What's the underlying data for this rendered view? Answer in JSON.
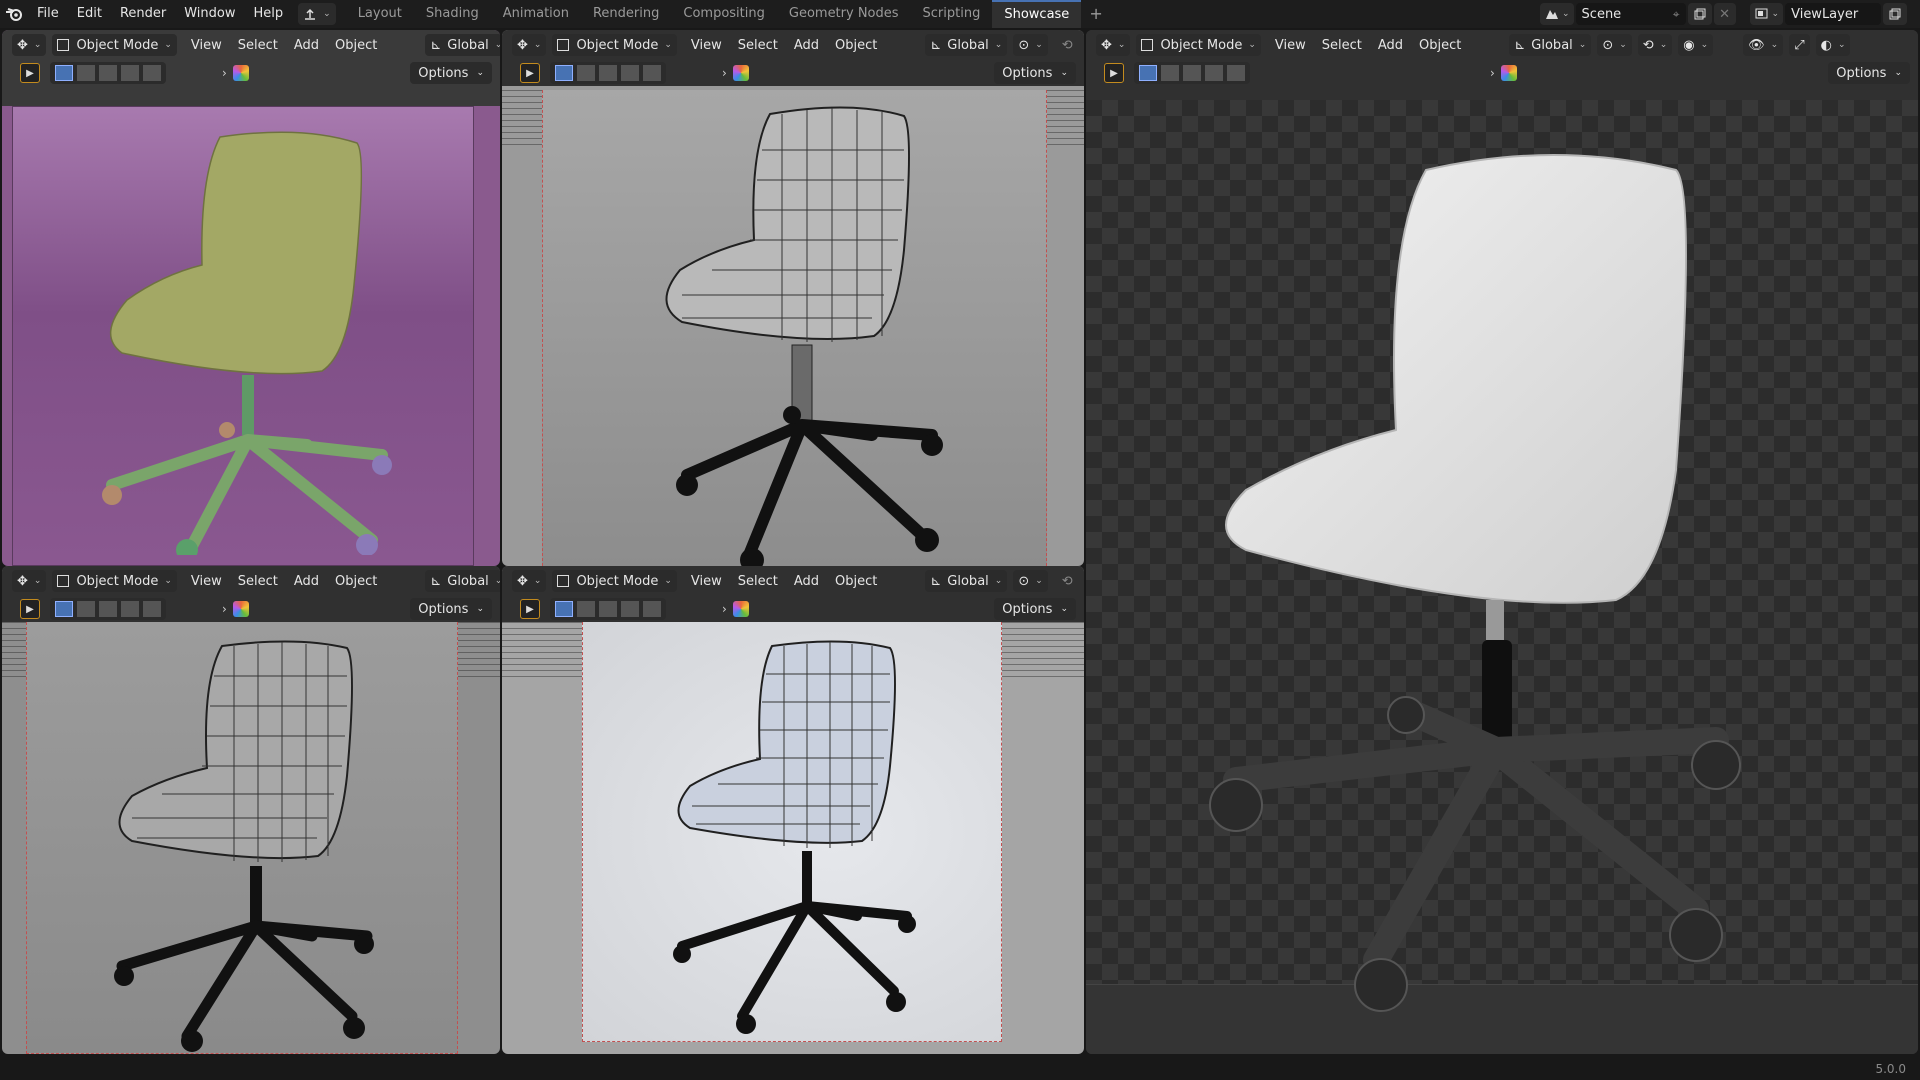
{
  "menu": [
    "File",
    "Edit",
    "Render",
    "Window",
    "Help"
  ],
  "workspaces": [
    "Layout",
    "Shading",
    "Animation",
    "Rendering",
    "Compositing",
    "Geometry Nodes",
    "Scripting",
    "Showcase"
  ],
  "active_workspace": "Showcase",
  "scene": {
    "label": "Scene",
    "view_layer": "ViewLayer"
  },
  "viewport_header": {
    "mode": "Object Mode",
    "menus": [
      "View",
      "Select",
      "Add",
      "Object"
    ],
    "orientation": "Global",
    "options": "Options"
  },
  "version": "5.0.0",
  "colors": {
    "accent": "#4772b3",
    "select_outline": "#c38b1e",
    "camera_frame": "#c25050"
  },
  "icons": [
    "blender-logo-icon",
    "editor-type-icon",
    "object-mode-icon",
    "transform-orientation-icon",
    "pivot-icon",
    "snap-icon",
    "proportional-icon",
    "overlay-icon",
    "shading-icon",
    "select-box-icon",
    "navigation-gizmo-icon"
  ]
}
